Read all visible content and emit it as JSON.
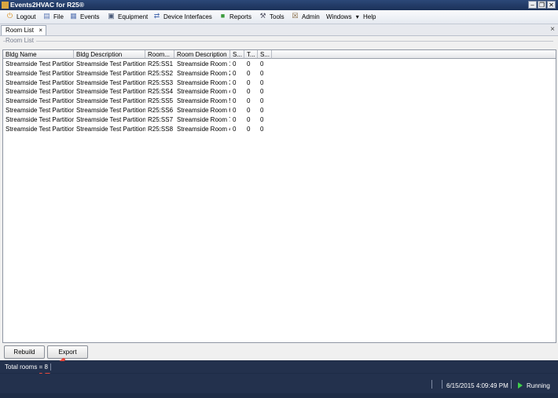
{
  "window": {
    "title": "Events2HVAC for R25®",
    "minimize_glyph": "–",
    "restore_glyph": "❐",
    "close_glyph": "✕"
  },
  "menu": [
    {
      "label": "Logout",
      "icon": "logout-icon",
      "glyph": "⏻",
      "color": "#d98c1a"
    },
    {
      "label": "File",
      "icon": "file-icon",
      "glyph": "▤",
      "color": "#5d79b5"
    },
    {
      "label": "Events",
      "icon": "events-icon",
      "glyph": "▦",
      "color": "#5d79b5"
    },
    {
      "label": "Equipment",
      "icon": "equipment-icon",
      "glyph": "▣",
      "color": "#4a5a78"
    },
    {
      "label": "Device Interfaces",
      "icon": "device-interfaces-icon",
      "glyph": "⇄",
      "color": "#4a6cb0"
    },
    {
      "label": "Reports",
      "icon": "reports-icon",
      "glyph": "■",
      "color": "#3b9a3b"
    },
    {
      "label": "Tools",
      "icon": "tools-icon",
      "glyph": "⚒",
      "color": "#556"
    },
    {
      "label": "Admin",
      "icon": "admin-icon",
      "glyph": "☒",
      "color": "#7a5b2e"
    },
    {
      "label": "Windows",
      "icon": "",
      "glyph": "",
      "color": ""
    },
    {
      "label": "Help",
      "icon": "",
      "glyph": "",
      "color": ""
    }
  ],
  "windows_dropdown_glyph": "▾",
  "tab": {
    "label": "Room List",
    "close_glyph": "×"
  },
  "tabbar_close_glyph": "×",
  "panel": {
    "header": "Room List"
  },
  "table": {
    "columns": [
      "Bldg Name",
      "Bldg Description",
      "Room...",
      "Room Description",
      "S...",
      "T...",
      "S..."
    ],
    "rows": [
      [
        "Streamside Test Partition",
        "Streamside Test Partition",
        "R25:SS1",
        "Streamside Room 1",
        "0",
        "0",
        "0"
      ],
      [
        "Streamside Test Partition",
        "Streamside Test Partition",
        "R25:SS2",
        "Streamside Room 2",
        "0",
        "0",
        "0"
      ],
      [
        "Streamside Test Partition",
        "Streamside Test Partition",
        "R25:SS3",
        "Streamside Room 3",
        "0",
        "0",
        "0"
      ],
      [
        "Streamside Test Partition",
        "Streamside Test Partition",
        "R25:SS4",
        "Streamside Room 4",
        "0",
        "0",
        "0"
      ],
      [
        "Streamside Test Partition",
        "Streamside Test Partition",
        "R25:SS5",
        "Streamside Room 5",
        "0",
        "0",
        "0"
      ],
      [
        "Streamside Test Partition",
        "Streamside Test Partition",
        "R25:SS6",
        "Streamside Room 6",
        "0",
        "0",
        "0"
      ],
      [
        "Streamside Test Partition",
        "Streamside Test Partition",
        "R25:SS7",
        "Streamside Room 7",
        "0",
        "0",
        "0"
      ],
      [
        "Streamside Test Partition",
        "Streamside Test Partition",
        "R25:SS8",
        "Streamside Room 4",
        "0",
        "0",
        "0"
      ]
    ]
  },
  "buttons": {
    "rebuild": "Rebuild",
    "export": "Export"
  },
  "status": {
    "total": "Total rooms = 8",
    "datetime": "6/15/2015 4:09:49 PM",
    "state": "Running"
  },
  "colors": {
    "arrow": "#e8473a",
    "running": "#3fd04a",
    "titlebar": "#1b3158"
  }
}
